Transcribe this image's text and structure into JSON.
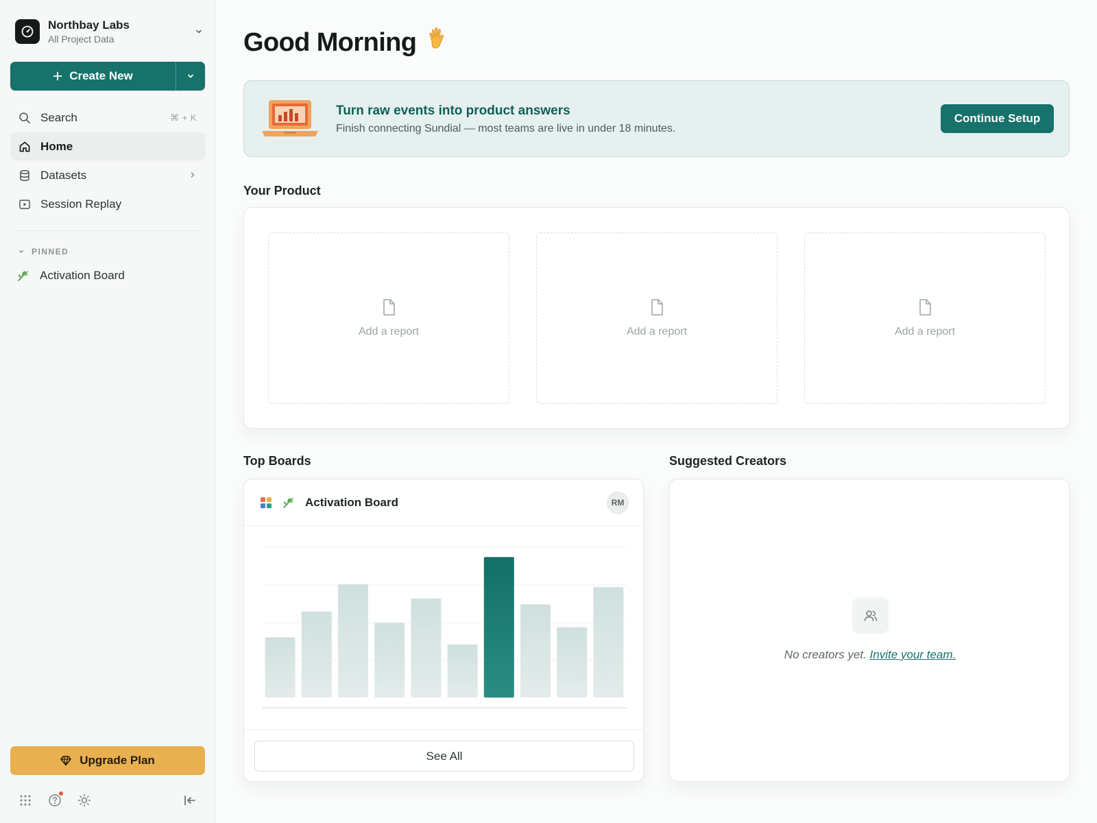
{
  "workspace": {
    "name": "Northbay Labs",
    "subtitle": "All Project Data"
  },
  "sidebar": {
    "create_label": "Create New",
    "search": {
      "label": "Search",
      "shortcut": "⌘ + K"
    },
    "items": [
      {
        "label": "Home",
        "icon": "home-icon",
        "active": true
      },
      {
        "label": "Datasets",
        "icon": "database-icon"
      },
      {
        "label": "Session Replay",
        "icon": "play-square-icon"
      }
    ],
    "pinned_heading": "PINNED",
    "pinned": [
      {
        "label": "Activation Board",
        "icon": "leaf-icon"
      }
    ],
    "upgrade_label": "Upgrade Plan"
  },
  "main": {
    "greeting": "Good Morning",
    "greeting_emoji": "👋",
    "banner": {
      "title": "Turn raw events into product answers",
      "subtitle": "Finish connecting Sundial — most teams are live in under 18 minutes.",
      "button": "Continue Setup"
    },
    "your_product": {
      "title": "Your Product",
      "slots": [
        "Add a report",
        "Add a report",
        "Add a report"
      ]
    },
    "top_boards": {
      "title": "Top Boards",
      "board_title": "Activation Board",
      "avatar": "RM",
      "see_all": "See All"
    },
    "suggested_creators": {
      "title": "Suggested Creators",
      "empty_text": "No creators yet.",
      "empty_link": "Invite your team."
    }
  },
  "chart_data": {
    "type": "bar",
    "values": [
      42,
      60,
      79,
      52,
      69,
      37,
      98,
      65,
      49,
      77
    ],
    "highlight_index": 6,
    "ylim": [
      0,
      112
    ],
    "grid": true
  },
  "colors": {
    "accent": "#16726a",
    "accent_dark": "#0f5f58",
    "upgrade": "#e9b04f",
    "bar": "#d3e3e1",
    "bar_highlight": "#1a7a72"
  }
}
